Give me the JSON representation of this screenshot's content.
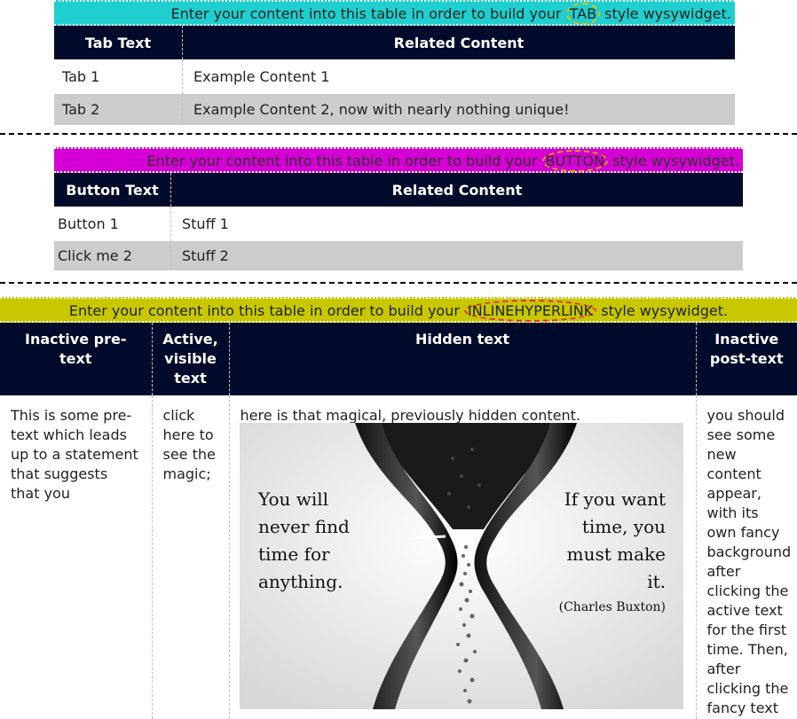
{
  "colors": {
    "tab_banner": "#1fcfcf",
    "button_banner": "#d400d4",
    "inline_banner": "#c8c800",
    "header_bg": "#000a2a",
    "row_alt": "#cccccc",
    "highlight_tab": "#e0c000",
    "highlight_button": "#e0a000",
    "highlight_inline": "#e03040"
  },
  "tab_widget": {
    "banner_before": "Enter your content into this table in order to build your ",
    "banner_keyword": "TAB",
    "banner_after": " style wysywidget.",
    "headers": [
      "Tab Text",
      "Related Content"
    ],
    "rows": [
      [
        "Tab 1",
        "Example Content 1"
      ],
      [
        "Tab 2",
        "Example Content 2, now with nearly nothing unique!"
      ]
    ]
  },
  "button_widget": {
    "banner_before": "Enter your content into this table in order to build your ",
    "banner_keyword": "BUTTON",
    "banner_after": " style wysywidget.",
    "headers": [
      "Button Text",
      "Related Content"
    ],
    "rows": [
      [
        "Button 1",
        "Stuff 1"
      ],
      [
        "Click me 2",
        "Stuff 2"
      ]
    ]
  },
  "inline_widget": {
    "banner_before": "Enter your content into this table in order to build your ",
    "banner_keyword": "INLINEHYPERLINK",
    "banner_after": " style wysywidget.",
    "headers": [
      "Inactive pre-text",
      "Active, visible text",
      "Hidden text",
      "Inactive post-text"
    ],
    "pre_text": "This is some pre-text which leads up to a statement that suggests that you",
    "active_text": "click here to see the magic;",
    "hidden_text": "here is that magical, previously hidden content.",
    "post_text": "you should see some new content appear, with its own fancy background after clicking the active text for the first time. Then, after clicking the fancy text",
    "image": {
      "quote_left": "You will never find time for anything.",
      "quote_right": "If you want time, you must make it.",
      "attribution": "(Charles Buxton)"
    }
  }
}
